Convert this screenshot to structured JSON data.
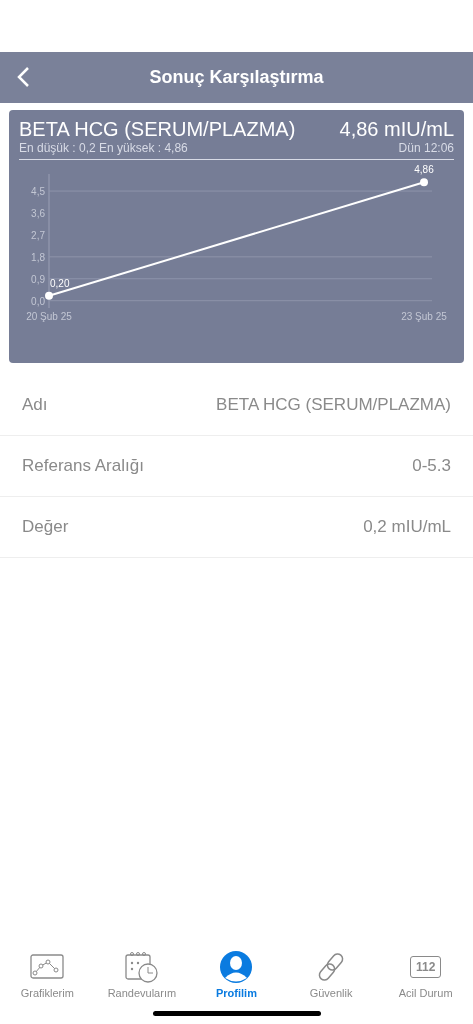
{
  "header": {
    "title": "Sonuç Karşılaştırma"
  },
  "card": {
    "test_name": "BETA HCG (SERUM/PLAZMA)",
    "value": "4,86 mIU/mL",
    "range_summary": "En düşük : 0,2 En yüksek : 4,86",
    "time": "Dün 12:06",
    "chart_data": {
      "type": "line",
      "categories": [
        "20 Şub 25",
        "23 Şub 25"
      ],
      "series": [
        {
          "color": "#ffffff",
          "marker": "circle",
          "values": [
            0.2,
            4.86
          ]
        }
      ],
      "ylim": [
        -0.3,
        5.2
      ],
      "yticks": [
        {
          "value": 0,
          "label": "0,0"
        },
        {
          "value": 0.9,
          "label": "0,9"
        },
        {
          "value": 1.8,
          "label": "1,8"
        },
        {
          "value": 2.7,
          "label": "2,7"
        },
        {
          "value": 3.6,
          "label": "3,6"
        },
        {
          "value": 4.5,
          "label": "4,5"
        }
      ],
      "value_labels": [
        "0,20",
        "4,86"
      ],
      "ref_lines": [
        {
          "axis": "y",
          "value": 0
        },
        {
          "axis": "y",
          "value": 0.9
        },
        {
          "axis": "y",
          "value": 1.8
        },
        {
          "axis": "y",
          "value": 4.5
        }
      ]
    }
  },
  "details": [
    {
      "label": "Adı",
      "value": "BETA HCG (SERUM/PLAZMA)"
    },
    {
      "label": "Referans Aralığı",
      "value": "0-5.3"
    },
    {
      "label": "Değer",
      "value": "0,2 mIU/mL"
    }
  ],
  "tabs": [
    {
      "label": "Grafiklerim",
      "selected": false
    },
    {
      "label": "Randevularım",
      "selected": false
    },
    {
      "label": "Profilim",
      "selected": true
    },
    {
      "label": "Güvenlik",
      "selected": false
    },
    {
      "label": "Acil Durum",
      "badge": "112",
      "selected": false
    }
  ]
}
